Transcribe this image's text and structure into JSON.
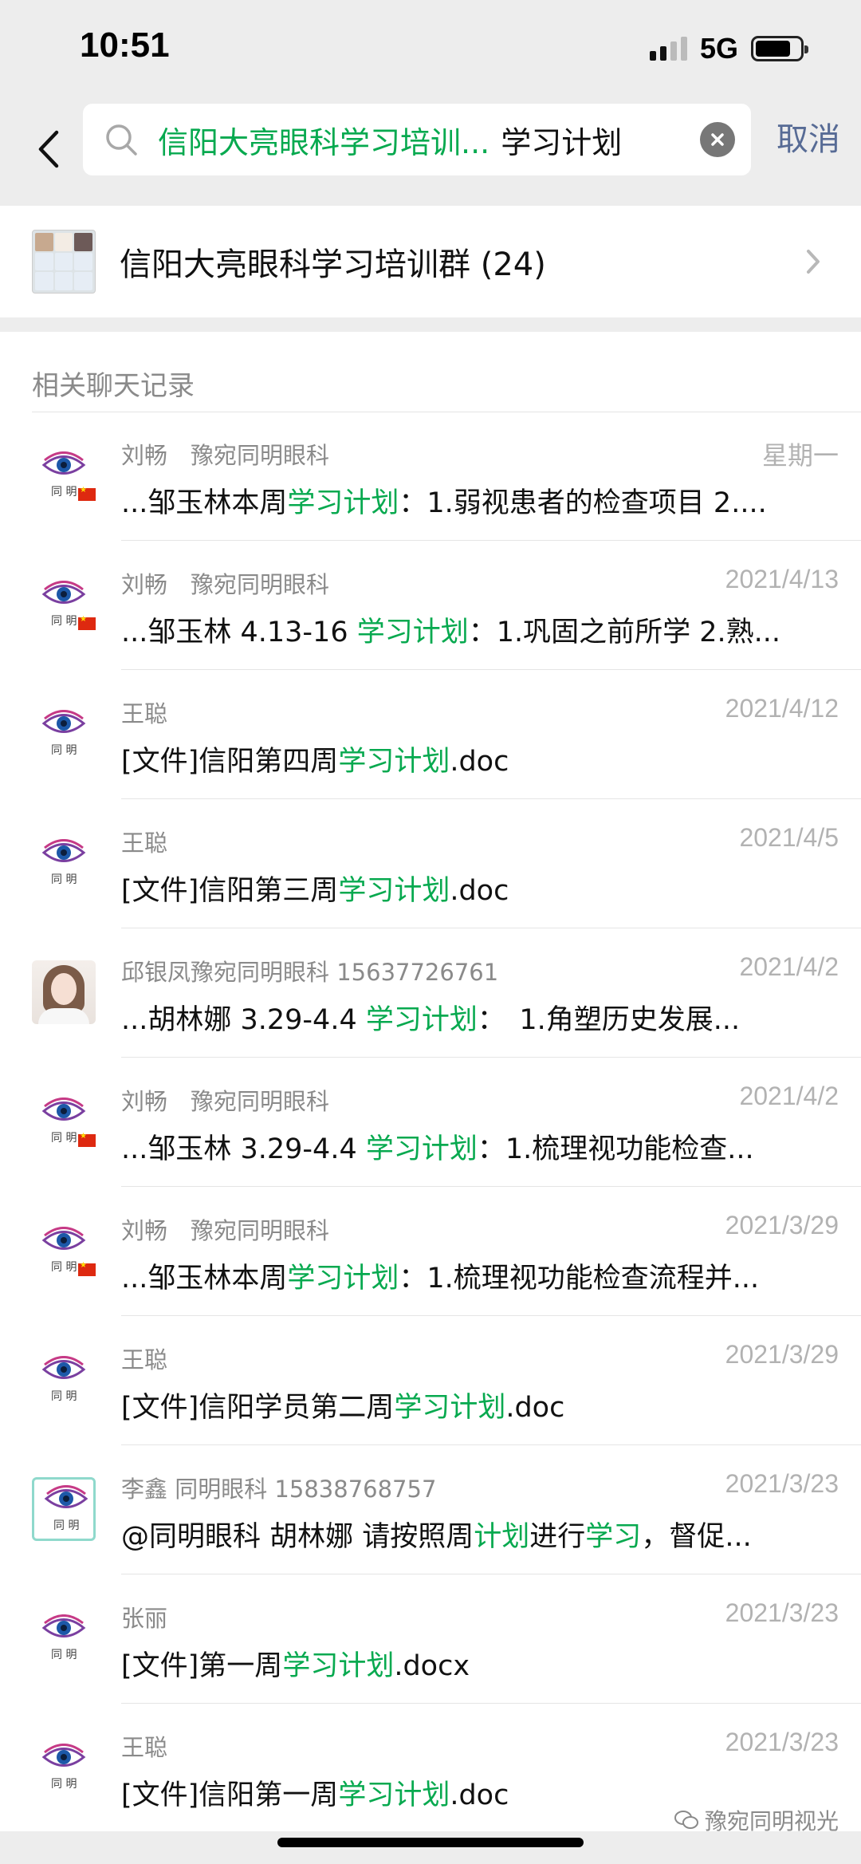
{
  "status_bar": {
    "time": "10:51",
    "network": "5G",
    "battery_level": 0.8
  },
  "search": {
    "tag": "信阳大亮眼科学习培训...",
    "query": "学习计划",
    "cancel_label": "取消"
  },
  "group": {
    "name": "信阳大亮眼科学习培训群 (24)"
  },
  "section": {
    "title": "相关聊天记录"
  },
  "results": [
    {
      "avatar": "eye-logo-flag",
      "name": "刘畅　豫宛同明眼科",
      "time": "星期一",
      "msg": [
        {
          "t": "...邹玉林本周"
        },
        {
          "t": "学习计划",
          "h": true
        },
        {
          "t": "：1.弱视患者的检查项目 2...."
        }
      ]
    },
    {
      "avatar": "eye-logo-flag",
      "name": "刘畅　豫宛同明眼科",
      "time": "2021/4/13",
      "msg": [
        {
          "t": "...邹玉林 4.13-16 "
        },
        {
          "t": "学习计划",
          "h": true
        },
        {
          "t": "：1.巩固之前所学 2.熟..."
        }
      ]
    },
    {
      "avatar": "eye-logo",
      "name": "王聪",
      "time": "2021/4/12",
      "msg": [
        {
          "t": "[文件]信阳第四周"
        },
        {
          "t": "学习计划",
          "h": true
        },
        {
          "t": ".doc"
        }
      ]
    },
    {
      "avatar": "eye-logo",
      "name": "王聪",
      "time": "2021/4/5",
      "msg": [
        {
          "t": "[文件]信阳第三周"
        },
        {
          "t": "学习计划",
          "h": true
        },
        {
          "t": ".doc"
        }
      ]
    },
    {
      "avatar": "photo",
      "name": "邱银凤豫宛同明眼科 15637726761",
      "time": "2021/4/2",
      "msg": [
        {
          "t": "...胡林娜 3.29-4.4 "
        },
        {
          "t": "学习计划",
          "h": true
        },
        {
          "t": "：　1.角塑历史发展..."
        }
      ]
    },
    {
      "avatar": "eye-logo-flag",
      "name": "刘畅　豫宛同明眼科",
      "time": "2021/4/2",
      "msg": [
        {
          "t": "...邹玉林 3.29-4.4 "
        },
        {
          "t": "学习计划",
          "h": true
        },
        {
          "t": "：1.梳理视功能检查..."
        }
      ]
    },
    {
      "avatar": "eye-logo-flag",
      "name": "刘畅　豫宛同明眼科",
      "time": "2021/3/29",
      "msg": [
        {
          "t": "...邹玉林本周"
        },
        {
          "t": "学习计划",
          "h": true
        },
        {
          "t": "：1.梳理视功能检查流程并..."
        }
      ]
    },
    {
      "avatar": "eye-logo",
      "name": "王聪",
      "time": "2021/3/29",
      "msg": [
        {
          "t": "[文件]信阳学员第二周"
        },
        {
          "t": "学习计划",
          "h": true
        },
        {
          "t": ".doc"
        }
      ]
    },
    {
      "avatar": "eye-logo-boxed",
      "name": "李鑫 同明眼科 15838768757",
      "time": "2021/3/23",
      "msg": [
        {
          "t": "@同明眼科 胡林娜  请按照周"
        },
        {
          "t": "计划",
          "h": true
        },
        {
          "t": "进行"
        },
        {
          "t": "学习",
          "h": true
        },
        {
          "t": "，督促..."
        }
      ]
    },
    {
      "avatar": "eye-logo",
      "name": "张丽",
      "time": "2021/3/23",
      "msg": [
        {
          "t": "[文件]第一周"
        },
        {
          "t": "学习计划",
          "h": true
        },
        {
          "t": ".docx"
        }
      ]
    },
    {
      "avatar": "eye-logo",
      "name": "王聪",
      "time": "2021/3/23",
      "msg": [
        {
          "t": "[文件]信阳第一周"
        },
        {
          "t": "学习计划",
          "h": true
        },
        {
          "t": ".doc"
        }
      ]
    }
  ],
  "logo_text": "同 明",
  "watermark": "豫宛同明视光",
  "colors": {
    "highlight": "#07a94f",
    "link": "#576b95",
    "background": "#ededed"
  }
}
